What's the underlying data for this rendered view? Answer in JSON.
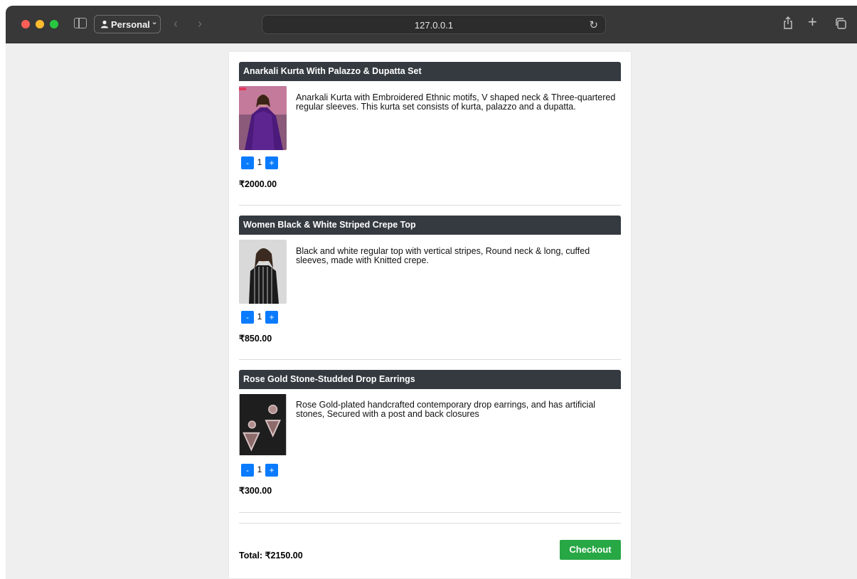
{
  "browser": {
    "profile_label": "Personal",
    "url": "127.0.0.1"
  },
  "cart": {
    "items": [
      {
        "title": "Anarkali Kurta With Palazzo & Dupatta Set",
        "description": "Anarkali Kurta with Embroidered Ethnic motifs, V shaped neck & Three-quartered regular sleeves. This kurta set consists of kurta, palazzo and a dupatta.",
        "quantity": "1",
        "price": "₹2000.00"
      },
      {
        "title": "Women Black & White Striped Crepe Top",
        "description": "Black and white regular top with vertical stripes, Round neck & long, cuffed sleeves, made with Knitted crepe.",
        "quantity": "1",
        "price": "₹850.00"
      },
      {
        "title": "Rose Gold Stone-Studded Drop Earrings",
        "description": "Rose Gold-plated handcrafted contemporary drop earrings, and has artificial stones, Secured with a post and back closures",
        "quantity": "1",
        "price": "₹300.00"
      }
    ],
    "minus_label": "-",
    "plus_label": "+",
    "total": "Total: ₹2150.00",
    "checkout_label": "Checkout"
  }
}
